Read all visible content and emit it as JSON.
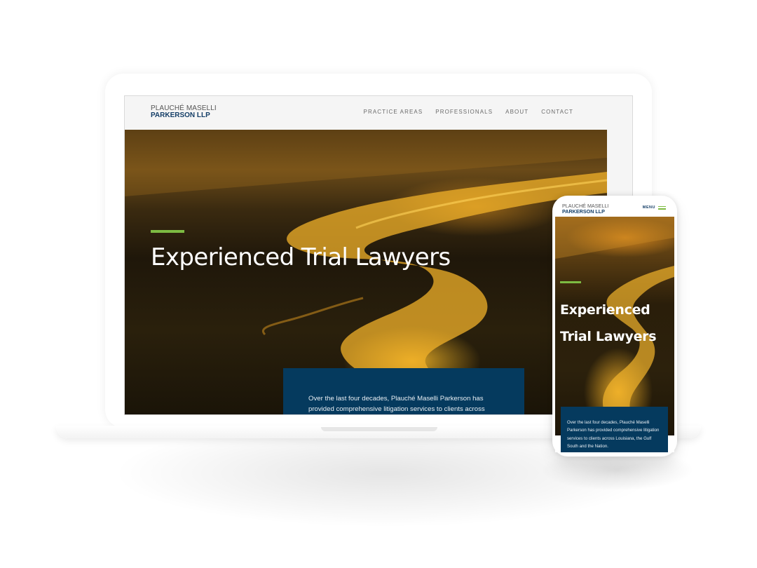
{
  "laptop_site": {
    "logo": {
      "line1": "PLAUCHÉ MASELLI",
      "line2": "PARKERSON LLP"
    },
    "nav": [
      "PRACTICE AREAS",
      "PROFESSIONALS",
      "ABOUT",
      "CONTACT"
    ],
    "hero": {
      "title": "Experienced Trial Lawyers",
      "intro": "Over the last four decades, Plauché Maselli Parkerson has provided comprehensive litigation services to clients across"
    }
  },
  "mobile_site": {
    "logo": {
      "line1": "PLAUCHÉ MASELLI",
      "line2": "PARKERSON LLP"
    },
    "menu_label": "MENU",
    "hero": {
      "title": "Experienced Trial Lawyers",
      "intro": "Over the last four decades, Plauché Maselli Parkerson has provided comprehensive litigation services to clients across Louisiana, the Gulf South and the Nation."
    }
  },
  "colors": {
    "brand_navy": "#053a5e",
    "logo_navy": "#143e67",
    "accent_green": "#7dbb42"
  }
}
